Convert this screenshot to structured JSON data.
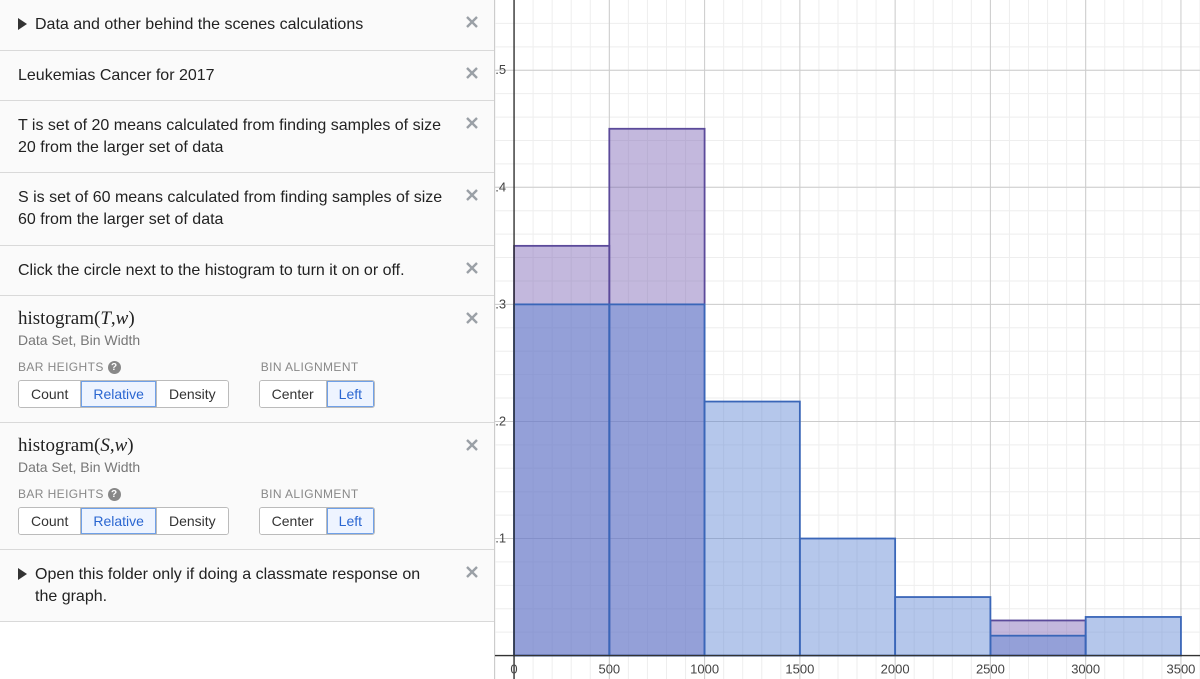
{
  "left": {
    "rows": [
      {
        "kind": "folder",
        "text": "Data and other behind the scenes calculations"
      },
      {
        "kind": "note",
        "text": "Leukemias Cancer for 2017"
      },
      {
        "kind": "note",
        "text": "T is set of 20 means calculated from finding samples of size 20 from the larger set of data"
      },
      {
        "kind": "note",
        "text": "S is set of 60 means calculated from finding samples of size 60 from the larger set of data"
      },
      {
        "kind": "note",
        "text": "Click the circle next to the histogram to turn it on or off."
      }
    ],
    "hist": [
      {
        "title_func": "histogram",
        "title_args_a": "T",
        "title_args_b": "w",
        "sub": "Data Set, Bin Width",
        "barheights_label": "BAR HEIGHTS",
        "align_label": "BIN ALIGNMENT",
        "bh_opts": [
          "Count",
          "Relative",
          "Density"
        ],
        "bh_sel": "Relative",
        "al_opts": [
          "Center",
          "Left"
        ],
        "al_sel": "Left"
      },
      {
        "title_func": "histogram",
        "title_args_a": "S",
        "title_args_b": "w",
        "sub": "Data Set, Bin Width",
        "barheights_label": "BAR HEIGHTS",
        "align_label": "BIN ALIGNMENT",
        "bh_opts": [
          "Count",
          "Relative",
          "Density"
        ],
        "bh_sel": "Relative",
        "al_opts": [
          "Center",
          "Left"
        ],
        "al_sel": "Left"
      }
    ],
    "last_folder": "Open this folder only if doing a classmate response on the graph."
  },
  "chart_data": {
    "type": "bar",
    "xlabel": "",
    "ylabel": "",
    "xlim": [
      -100,
      3600
    ],
    "ylim": [
      -0.02,
      0.56
    ],
    "x_ticks": [
      0,
      500,
      1000,
      1500,
      2000,
      2500,
      3000,
      3500
    ],
    "y_ticks": [
      0.1,
      0.2,
      0.3,
      0.4,
      0.5
    ],
    "bin_width": 500,
    "bin_edges": [
      0,
      500,
      1000,
      1500,
      2000,
      2500,
      3000,
      3500
    ],
    "series": [
      {
        "name": "T",
        "color": "#7b61b4",
        "values": [
          0.35,
          0.45,
          0.0,
          0.0,
          0.0,
          0.03,
          0.0
        ]
      },
      {
        "name": "S",
        "color": "#5a82d2",
        "values": [
          0.3,
          0.3,
          0.217,
          0.1,
          0.05,
          0.017,
          0.033
        ]
      }
    ]
  }
}
